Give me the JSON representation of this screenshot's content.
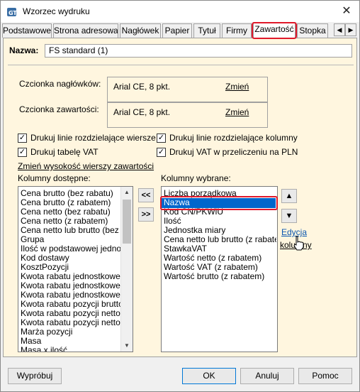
{
  "window": {
    "title": "Wzorzec wydruku"
  },
  "tabs": [
    {
      "label": "Podstawowe"
    },
    {
      "label": "Strona adresowa"
    },
    {
      "label": "Nagłówek"
    },
    {
      "label": "Papier"
    },
    {
      "label": "Tytuł"
    },
    {
      "label": "Firmy"
    },
    {
      "label": "Zawartość",
      "active": true
    },
    {
      "label": "Stopka"
    }
  ],
  "name_field": {
    "label": "Nazwa:",
    "value": "FS standard (1)"
  },
  "header_font": {
    "label": "Czcionka nagłówków:",
    "value": "Arial CE, 8 pkt.",
    "link": "Zmień"
  },
  "content_font": {
    "label": "Czcionka zawartości:",
    "value": "Arial CE, 8 pkt.",
    "link": "Zmień"
  },
  "checkboxes": [
    {
      "label": "Drukuj linie rozdzielające wiersze",
      "checked": true
    },
    {
      "label": "Drukuj linie rozdzielające kolumny",
      "checked": true
    },
    {
      "label": "Drukuj tabelę VAT",
      "checked": true
    },
    {
      "label": "Drukuj VAT w przeliczeniu na PLN",
      "checked": true
    }
  ],
  "row_height_link": "Zmień wysokość wierszy zawartości",
  "available": {
    "label": "Kolumny dostępne:",
    "items": [
      "Cena brutto (bez rabatu)",
      "Cena brutto (z rabatem)",
      "Cena netto (bez rabatu)",
      "Cena netto (z rabatem)",
      "Cena netto lub brutto (bez rab",
      "Grupa",
      "Ilość w podstawowej jednostc",
      "Kod dostawy",
      "KosztPozycji",
      "Kwota rabatu jednostkowego",
      "Kwota rabatu jednostkowego",
      "Kwota rabatu jednostkowego",
      "Kwota rabatu pozycji brutto",
      "Kwota rabatu pozycji netto",
      "Kwota rabatu pozycji netto lu",
      "Marża pozycji",
      "Masa",
      "Masa x ilość"
    ]
  },
  "move_buttons": {
    "remove": "<<",
    "add": ">>"
  },
  "selected": {
    "label": "Kolumny wybrane:",
    "items": [
      "Liczba porządkowa",
      "Nazwa",
      "Kod CN/PKWiU",
      "Ilość",
      "Jednostka miary",
      "Cena netto lub brutto (z rabatem",
      "StawkaVAT",
      "Wartość netto (z rabatem)",
      "Wartość VAT (z rabatem)",
      "Wartość brutto (z rabatem)"
    ],
    "selected_index": 1
  },
  "side": {
    "edit_link": "Edycja",
    "columns_link": "kolumny"
  },
  "footer": {
    "preview": "Wypróbuj",
    "ok": "OK",
    "cancel": "Anuluj",
    "help": "Pomoc"
  }
}
